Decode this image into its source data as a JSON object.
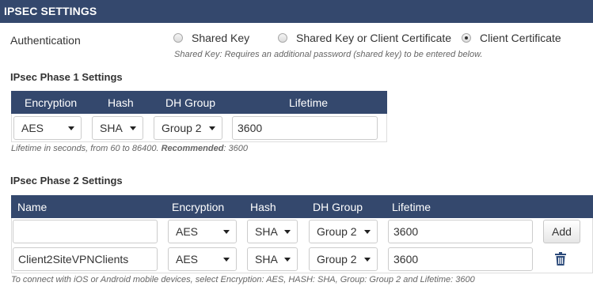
{
  "header": {
    "title": "IPSEC SETTINGS"
  },
  "authentication": {
    "label": "Authentication",
    "options": [
      {
        "label": "Shared Key",
        "selected": false
      },
      {
        "label": "Shared Key or Client Certificate",
        "selected": false
      },
      {
        "label": "Client Certificate",
        "selected": true
      }
    ],
    "help": "Shared Key: Requires an additional password (shared key) to be entered below."
  },
  "phase1": {
    "title": "IPsec Phase 1 Settings",
    "columns": {
      "encryption": "Encryption",
      "hash": "Hash",
      "dh_group": "DH Group",
      "lifetime": "Lifetime"
    },
    "values": {
      "encryption": "AES",
      "hash": "SHA",
      "dh_group": "Group 2",
      "lifetime": "3600"
    },
    "help_prefix": "Lifetime in seconds, from 60 to 86400. ",
    "help_bold": "Recommended",
    "help_suffix": ": 3600"
  },
  "phase2": {
    "title": "IPsec Phase 2 Settings",
    "columns": {
      "name": "Name",
      "encryption": "Encryption",
      "hash": "Hash",
      "dh_group": "DH Group",
      "lifetime": "Lifetime"
    },
    "new_row": {
      "name": "",
      "encryption": "AES",
      "hash": "SHA",
      "dh_group": "Group 2",
      "lifetime": "3600",
      "add_label": "Add"
    },
    "rows": [
      {
        "name": "Client2SiteVPNClients",
        "encryption": "AES",
        "hash": "SHA",
        "dh_group": "Group 2",
        "lifetime": "3600"
      }
    ],
    "help": "To connect with iOS or Android mobile devices, select Encryption: AES, HASH: SHA, Group: Group 2 and Lifetime: 3600"
  },
  "icons": {
    "delete": "trash-icon",
    "dropdown": "chevron-down-icon"
  }
}
